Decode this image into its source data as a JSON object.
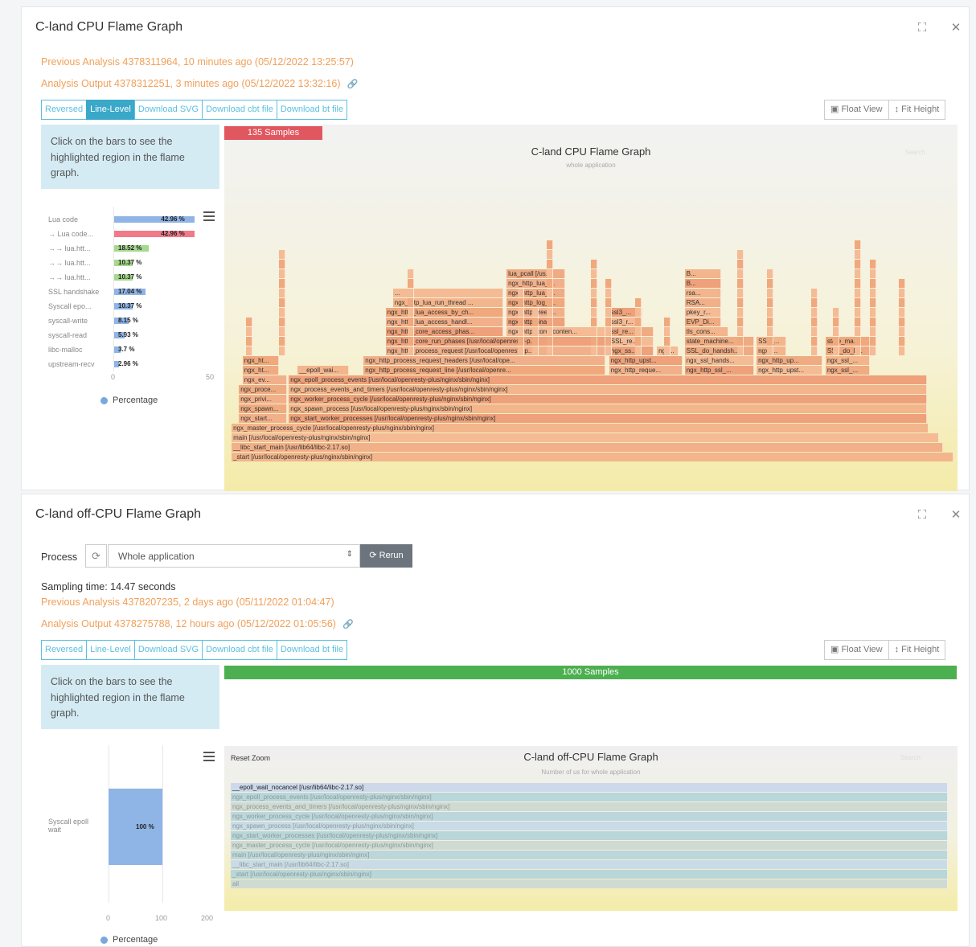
{
  "cpu_panel": {
    "title": "C-land CPU Flame Graph",
    "expand_icon": "expand-icon",
    "close_icon": "close-icon",
    "previous_analysis": "Previous Analysis 4378311964, 10 minutes ago (05/12/2022 13:25:57)",
    "analysis_output": "Analysis Output 4378312251, 3 minutes ago (05/12/2022 13:32:16)",
    "buttons": [
      "Reversed",
      "Line-Level",
      "Download SVG",
      "Download cbt file",
      "Download bt file"
    ],
    "active_button": "Line-Level",
    "float_view": "Float View",
    "fit_height": "Fit Height",
    "hint": "Click on the bars to see the highlighted region in the flame graph.",
    "samples": "135 Samples",
    "graph_title": "C-land CPU Flame Graph",
    "graph_subtitle": "whole application",
    "search_label": "Search",
    "breakdown": [
      {
        "label": "Lua code",
        "value": "42.96 %",
        "pct": 42.96,
        "color": "#8fb4e6"
      },
      {
        "label": "→ Lua code...",
        "value": "42.96 %",
        "pct": 42.96,
        "color": "#f07a88"
      },
      {
        "label": "→→ lua.htt...",
        "value": "18.52 %",
        "pct": 18.52,
        "color": "#a6d88f"
      },
      {
        "label": "→→ lua.htt...",
        "value": "10.37 %",
        "pct": 10.37,
        "color": "#a6d88f"
      },
      {
        "label": "→→ lua.htt...",
        "value": "10.37 %",
        "pct": 10.37,
        "color": "#a6d88f"
      },
      {
        "label": "SSL handshake",
        "value": "17.04 %",
        "pct": 17.04,
        "color": "#8fb4e6"
      },
      {
        "label": "Syscall epo...",
        "value": "10.37 %",
        "pct": 10.37,
        "color": "#8fb4e6"
      },
      {
        "label": "syscall-write",
        "value": "8.15 %",
        "pct": 8.15,
        "color": "#8fb4e6"
      },
      {
        "label": "syscall-read",
        "value": "5.93 %",
        "pct": 5.93,
        "color": "#8fb4e6"
      },
      {
        "label": "libc-malloc",
        "value": "3.7 %",
        "pct": 3.7,
        "color": "#8fb4e6"
      },
      {
        "label": "upstream-recv",
        "value": "2.96 %",
        "pct": 2.96,
        "color": "#8fb4e6"
      }
    ],
    "axis_ticks": [
      "0",
      "50"
    ],
    "legend": "Percentage",
    "flame_bars": [
      {
        "level": 0,
        "start": 0.01,
        "width": 0.985,
        "label": "_start [/usr/local/openresty-plus/nginx/sbin/nginx]"
      },
      {
        "level": 1,
        "start": 0.01,
        "width": 0.97,
        "label": "__libc_start_main [/usr/lib64/libc-2.17.so]"
      },
      {
        "level": 2,
        "start": 0.01,
        "width": 0.965,
        "label": "main [/usr/local/openresty-plus/nginx/sbin/nginx]"
      },
      {
        "level": 3,
        "start": 0.01,
        "width": 0.95,
        "label": "ngx_master_process_cycle [/usr/local/openresty-plus/nginx/sbin/nginx]"
      },
      {
        "level": 4,
        "start": 0.02,
        "width": 0.065,
        "label": "ngx_start..."
      },
      {
        "level": 4,
        "start": 0.088,
        "width": 0.87,
        "label": "ngx_start_worker_processes [/usr/local/openresty-plus/nginx/sbin/nginx]"
      },
      {
        "level": 5,
        "start": 0.02,
        "width": 0.065,
        "label": "ngx_spawn..."
      },
      {
        "level": 5,
        "start": 0.088,
        "width": 0.87,
        "label": "ngx_spawn_process [/usr/local/openresty-plus/nginx/sbin/nginx]"
      },
      {
        "level": 6,
        "start": 0.02,
        "width": 0.065,
        "label": "ngx_privi..."
      },
      {
        "level": 6,
        "start": 0.088,
        "width": 0.87,
        "label": "ngx_worker_process_cycle [/usr/local/openresty-plus/nginx/sbin/nginx]"
      },
      {
        "level": 7,
        "start": 0.02,
        "width": 0.065,
        "label": "ngx_proce..."
      },
      {
        "level": 7,
        "start": 0.088,
        "width": 0.87,
        "label": "ngx_process_events_and_timers [/usr/local/openresty-plus/nginx/sbin/nginx]"
      },
      {
        "level": 8,
        "start": 0.025,
        "width": 0.06,
        "label": "ngx_ev..."
      },
      {
        "level": 8,
        "start": 0.088,
        "width": 0.87,
        "label": "ngx_epoll_process_events [/usr/local/openresty-plus/nginx/sbin/nginx]"
      },
      {
        "level": 9,
        "start": 0.025,
        "width": 0.05,
        "label": "ngx_ht..."
      },
      {
        "level": 9,
        "start": 0.1,
        "width": 0.07,
        "label": "__epoll_wai..."
      },
      {
        "level": 9,
        "start": 0.19,
        "width": 0.33,
        "label": "ngx_http_process_request_line [/usr/local/openre..."
      },
      {
        "level": 9,
        "start": 0.525,
        "width": 0.1,
        "label": "ngx_http_reque..."
      },
      {
        "level": 9,
        "start": 0.628,
        "width": 0.095,
        "label": "ngx_http_ssl_..."
      },
      {
        "level": 9,
        "start": 0.726,
        "width": 0.09,
        "label": "ngx_http_upst..."
      },
      {
        "level": 9,
        "start": 0.82,
        "width": 0.06,
        "label": "ngx_ssl_..."
      },
      {
        "level": 10,
        "start": 0.025,
        "width": 0.05,
        "label": "ngx_ht..."
      },
      {
        "level": 10,
        "start": 0.19,
        "width": 0.33,
        "label": "ngx_http_process_request_headers [/usr/local/ope..."
      },
      {
        "level": 10,
        "start": 0.525,
        "width": 0.1,
        "label": "ngx_http_upst..."
      },
      {
        "level": 10,
        "start": 0.628,
        "width": 0.095,
        "label": "ngx_ssl_hands..."
      },
      {
        "level": 10,
        "start": 0.726,
        "width": 0.09,
        "label": "ngx_http_up..."
      },
      {
        "level": 10,
        "start": 0.82,
        "width": 0.06,
        "label": "ngx_ssl_..."
      },
      {
        "level": 11,
        "start": 0.22,
        "width": 0.3,
        "label": "ngx_http_process_request [/usr/local/openresty-p..."
      },
      {
        "level": 11,
        "start": 0.525,
        "width": 0.06,
        "label": "ngx_ss..."
      },
      {
        "level": 11,
        "start": 0.59,
        "width": 0.03,
        "label": "ngx..."
      },
      {
        "level": 11,
        "start": 0.628,
        "width": 0.095,
        "label": "SSL_do_handsh..."
      },
      {
        "level": 11,
        "start": 0.726,
        "width": 0.04,
        "label": "ngx_..."
      },
      {
        "level": 11,
        "start": 0.82,
        "width": 0.06,
        "label": "SSL_do_h..."
      },
      {
        "level": 12,
        "start": 0.22,
        "width": 0.3,
        "label": "ngx_http_core_run_phases [/usr/local/openresty-p..."
      },
      {
        "level": 12,
        "start": 0.525,
        "width": 0.06,
        "label": "SSL_re..."
      },
      {
        "level": 12,
        "start": 0.628,
        "width": 0.095,
        "label": "state_machine..."
      },
      {
        "level": 12,
        "start": 0.726,
        "width": 0.04,
        "label": "SSL_..."
      },
      {
        "level": 12,
        "start": 0.82,
        "width": 0.06,
        "label": "state_ma..."
      },
      {
        "level": 13,
        "start": 0.22,
        "width": 0.16,
        "label": "ngx_http_core_access_phas..."
      },
      {
        "level": 13,
        "start": 0.385,
        "width": 0.135,
        "label": "ngx_http_core_conten..."
      },
      {
        "level": 13,
        "start": 0.525,
        "width": 0.06,
        "label": "ssl_re..."
      },
      {
        "level": 13,
        "start": 0.628,
        "width": 0.06,
        "label": "tls_cons..."
      },
      {
        "level": 14,
        "start": 0.22,
        "width": 0.16,
        "label": "ngx_http_lua_access_handl..."
      },
      {
        "level": 14,
        "start": 0.385,
        "width": 0.08,
        "label": "ngx_http_final..."
      },
      {
        "level": 14,
        "start": 0.525,
        "width": 0.045,
        "label": "ssl3_r..."
      },
      {
        "level": 14,
        "start": 0.628,
        "width": 0.05,
        "label": "EVP_Di..."
      },
      {
        "level": 15,
        "start": 0.22,
        "width": 0.16,
        "label": "ngx_http_lua_access_by_ch..."
      },
      {
        "level": 15,
        "start": 0.385,
        "width": 0.08,
        "label": "ngx_http_free_..."
      },
      {
        "level": 15,
        "start": 0.525,
        "width": 0.045,
        "label": "ssl3_..."
      },
      {
        "level": 15,
        "start": 0.628,
        "width": 0.05,
        "label": "pkey_r..."
      },
      {
        "level": 16,
        "start": 0.23,
        "width": 0.15,
        "label": "ngx_http_lua_run_thread ..."
      },
      {
        "level": 16,
        "start": 0.385,
        "width": 0.08,
        "label": "ngx_http_log_r..."
      },
      {
        "level": 16,
        "start": 0.628,
        "width": 0.05,
        "label": "RSA..."
      },
      {
        "level": 17,
        "start": 0.23,
        "width": 0.15,
        "label": "..."
      },
      {
        "level": 17,
        "start": 0.385,
        "width": 0.08,
        "label": "ngx_http_lua_l..."
      },
      {
        "level": 17,
        "start": 0.628,
        "width": 0.05,
        "label": "rsa..."
      },
      {
        "level": 18,
        "start": 0.385,
        "width": 0.08,
        "label": "ngx_http_lua_l..."
      },
      {
        "level": 18,
        "start": 0.628,
        "width": 0.05,
        "label": "B..."
      },
      {
        "level": 19,
        "start": 0.385,
        "width": 0.08,
        "label": "lua_pcall [/us..."
      },
      {
        "level": 19,
        "start": 0.628,
        "width": 0.05,
        "label": "B..."
      }
    ]
  },
  "offcpu_panel": {
    "title": "C-land off-CPU Flame Graph",
    "expand_icon": "expand-icon",
    "close_icon": "close-icon",
    "process_label": "Process",
    "process_value": "Whole application",
    "rerun": "Rerun",
    "sampling_time": "Sampling time: 14.47 seconds",
    "previous_analysis": "Previous Analysis 4378207235, 2 days ago (05/11/2022 01:04:47)",
    "analysis_output": "Analysis Output 4378275788, 12 hours ago (05/12/2022 01:05:56)",
    "buttons": [
      "Reversed",
      "Line-Level",
      "Download SVG",
      "Download cbt file",
      "Download bt file"
    ],
    "float_view": "Float View",
    "fit_height": "Fit Height",
    "hint": "Click on the bars to see the highlighted region in the flame graph.",
    "samples": "1000 Samples",
    "reset_zoom": "Reset Zoom",
    "graph_title": "C-land off-CPU Flame Graph",
    "graph_subtitle": "Number of us for whole application",
    "search_label": "Search",
    "breakdown_label": "Syscall epoll wait",
    "breakdown_value": "100 %",
    "breakdown_pct": 100,
    "axis_ticks": [
      "0",
      "100",
      "200"
    ],
    "legend": "Percentage",
    "stack": [
      "__epoll_wait_nocancel [/usr/lib64/libc-2.17.so]",
      "ngx_epoll_process_events [/usr/local/openresty-plus/nginx/sbin/nginx]",
      "ngx_process_events_and_timers [/usr/local/openresty-plus/nginx/sbin/nginx]",
      "ngx_worker_process_cycle [/usr/local/openresty-plus/nginx/sbin/nginx]",
      "ngx_spawn_process [/usr/local/openresty-plus/nginx/sbin/nginx]",
      "ngx_start_worker_processes [/usr/local/openresty-plus/nginx/sbin/nginx]",
      "ngx_master_process_cycle [/usr/local/openresty-plus/nginx/sbin/nginx]",
      "main [/usr/local/openresty-plus/nginx/sbin/nginx]",
      "__libc_start_main [/usr/lib64/libc-2.17.so]",
      "_start [/usr/local/openresty-plus/nginx/sbin/nginx]",
      "all"
    ]
  }
}
